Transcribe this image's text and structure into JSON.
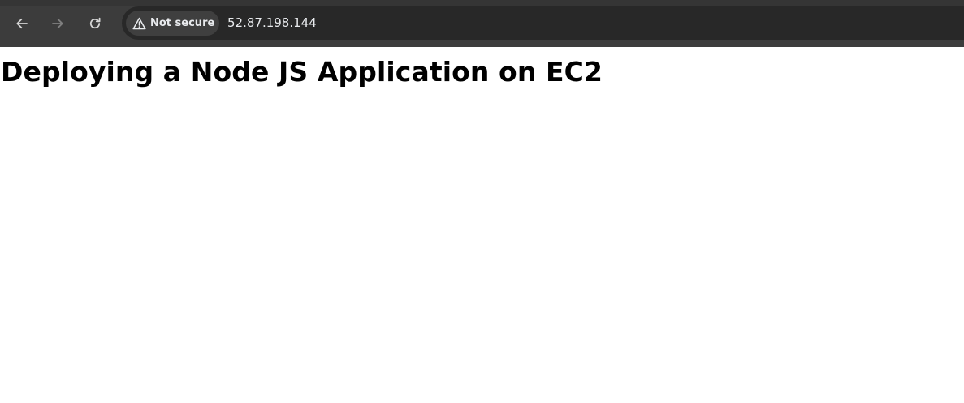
{
  "browser": {
    "back_icon": "arrow-left-icon",
    "forward_icon": "arrow-right-icon",
    "reload_icon": "reload-icon",
    "security": {
      "icon": "warning-triangle-icon",
      "label": "Not secure"
    },
    "url": "52.87.198.144",
    "colors": {
      "toolbar": "#3c3c3c",
      "omnibox": "#282828",
      "chip": "#3f3f3f",
      "text": "#e8eaed"
    }
  },
  "page": {
    "heading": "Deploying a Node JS Application on EC2"
  }
}
